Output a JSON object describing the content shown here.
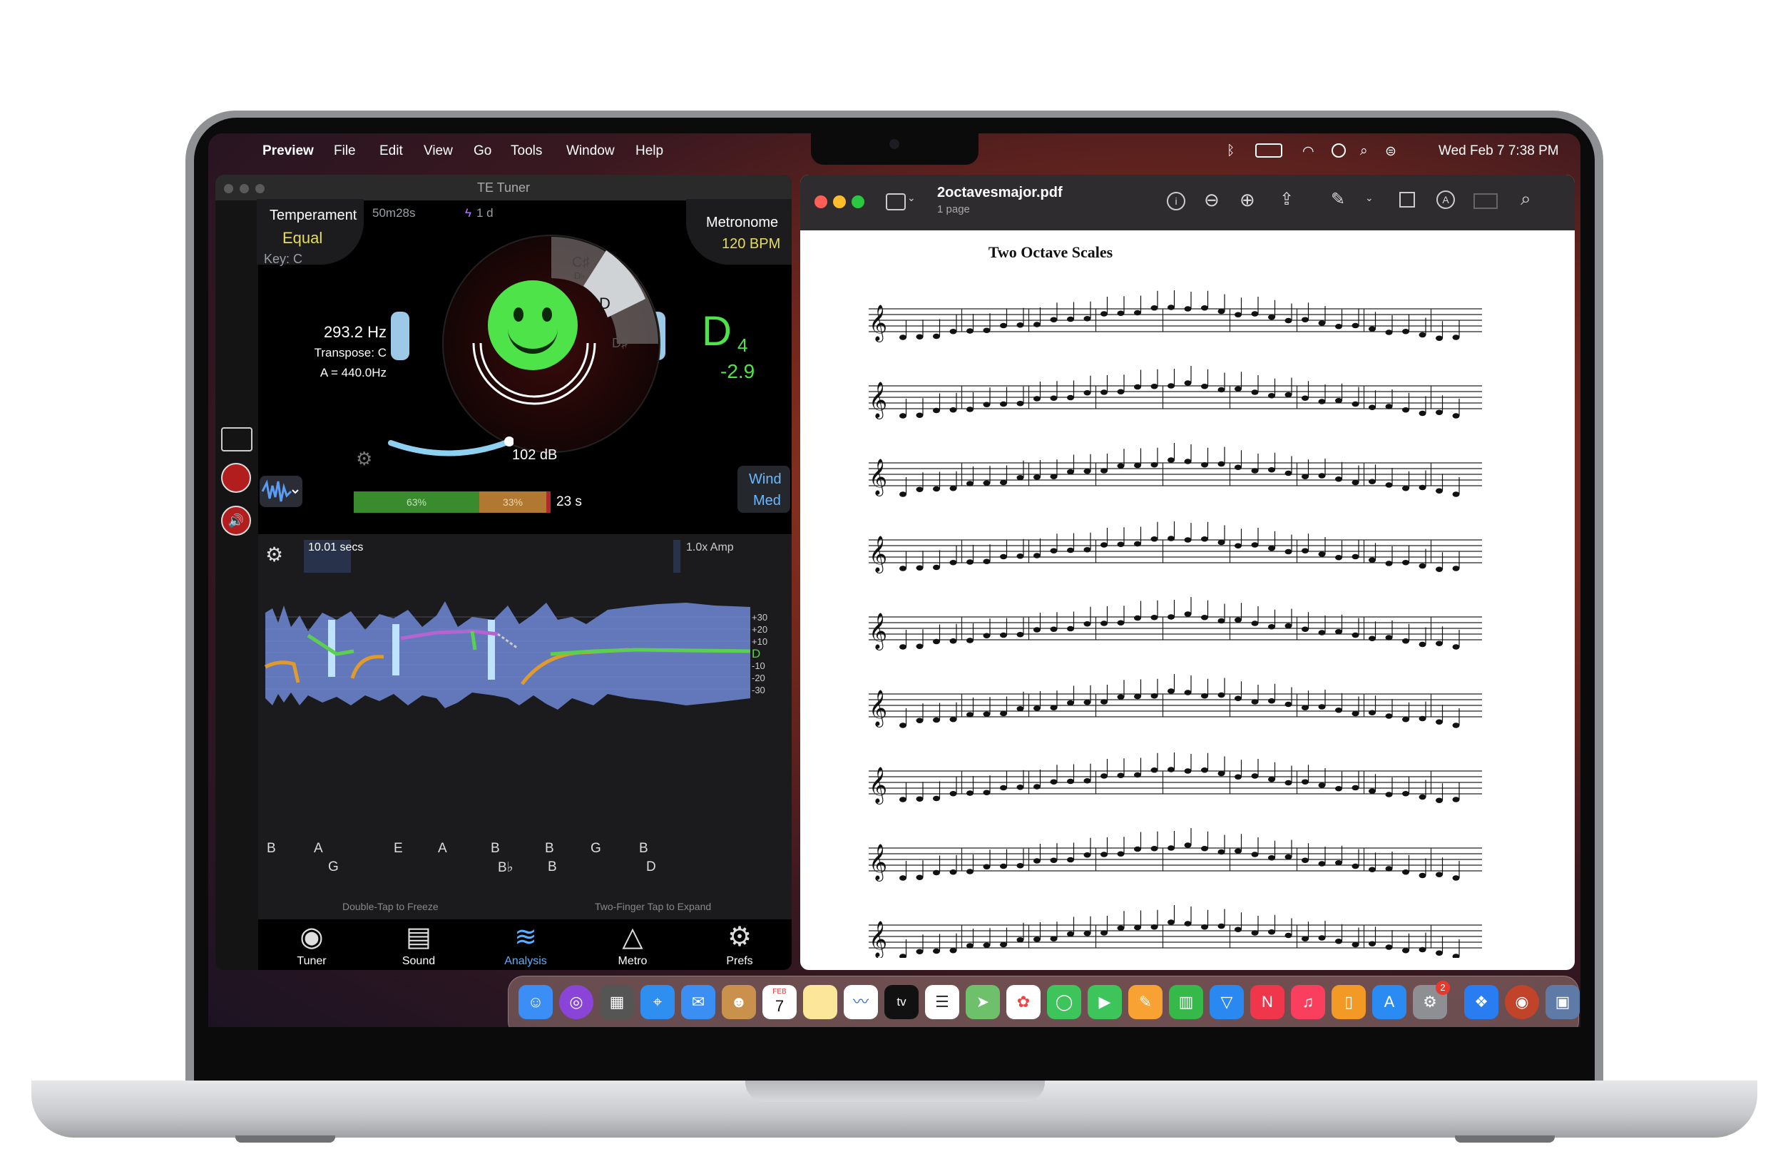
{
  "menubar": {
    "app_name": "Preview",
    "menus": [
      "File",
      "Edit",
      "View",
      "Go",
      "Tools",
      "Window",
      "Help"
    ],
    "datetime": "Wed Feb 7  7:38 PM"
  },
  "tuner": {
    "window_title": "TE Tuner",
    "temperament_label": "Temperament",
    "temperament_value": "Equal",
    "key": "Key: C",
    "elapsed": "50m28s",
    "streak": "1 d",
    "metronome_label": "Metronome",
    "metronome_value": "120 BPM",
    "frequency": "293.2 Hz",
    "transpose": "Transpose: C",
    "reference": "A = 440.0Hz",
    "note": "D",
    "octave": "4",
    "cents": "-2.9",
    "dial_notes": [
      "C♯",
      "D♭",
      "D",
      "D♯"
    ],
    "decibels": "102 dB",
    "bar_green": "63%",
    "bar_orange": "33%",
    "bar_time": "23 s",
    "wind_label": "Wind",
    "wind_value": "Med",
    "analysis": {
      "window": "10.01 secs",
      "amp": "1.0x Amp",
      "scale": [
        "+30",
        "+20",
        "+10",
        "D",
        "-10",
        "-20",
        "-30"
      ],
      "notes_row1": [
        "B",
        "A",
        "E",
        "A",
        "B",
        "B",
        "G",
        "B"
      ],
      "notes_row2": [
        "G",
        "B♭",
        "B",
        "D"
      ],
      "hint_left": "Double-Tap to Freeze",
      "hint_right": "Two-Finger Tap to Expand"
    },
    "tabs": [
      "Tuner",
      "Sound",
      "Analysis",
      "Metro",
      "Prefs"
    ]
  },
  "preview": {
    "filename": "2octavesmajor.pdf",
    "page_count": "1 page",
    "doc_title": "Two Octave Scales"
  },
  "dock": {
    "calendar_month": "FEB",
    "calendar_day": "7",
    "tv_label": "tv",
    "badge": "2"
  },
  "colors": {
    "tuner_green": "#4fe34a",
    "tuner_yellow": "#e6dd5a",
    "tab_active": "#5ab0ff"
  }
}
